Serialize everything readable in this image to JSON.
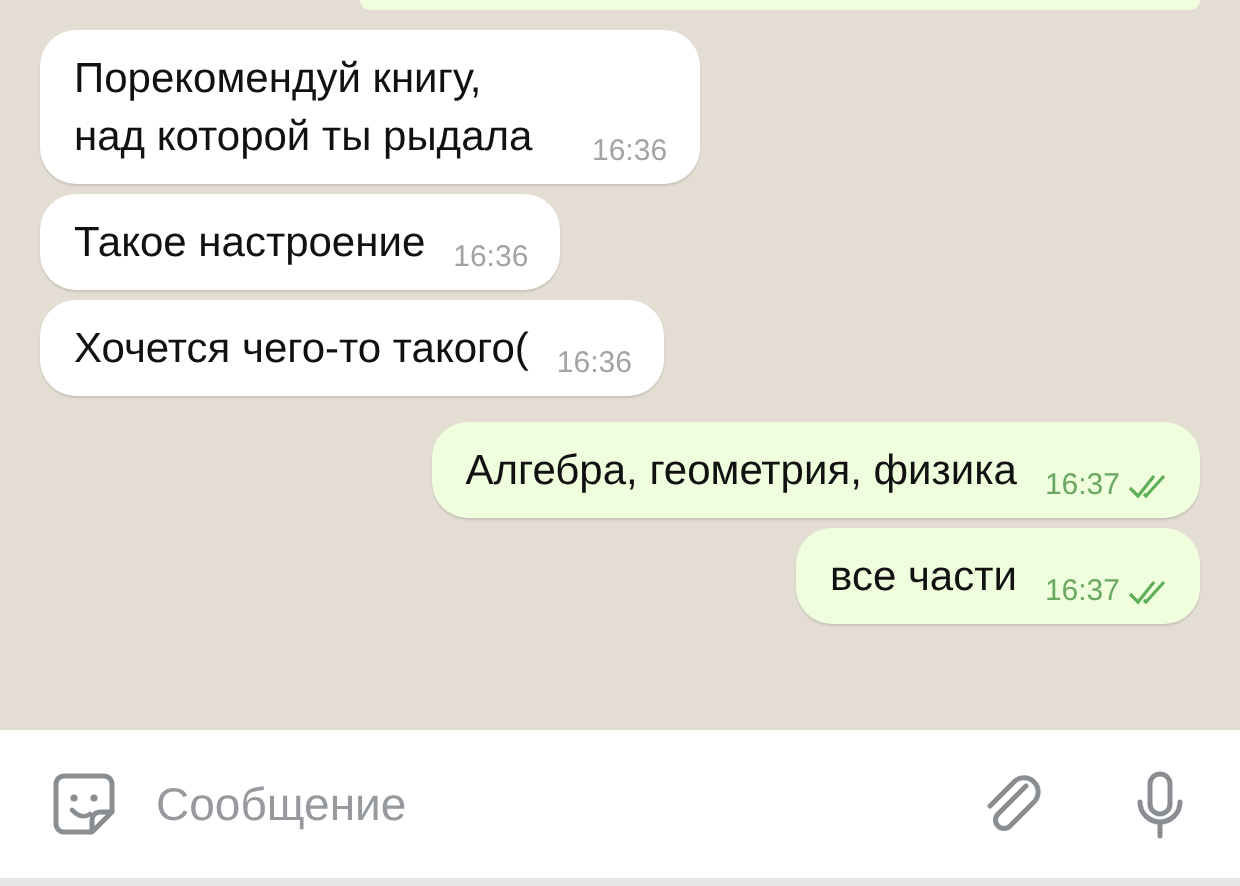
{
  "messages": [
    {
      "kind": "incoming",
      "text": "Порекомендуй книгу, над которой ты рыдала",
      "time": "16:36"
    },
    {
      "kind": "incoming",
      "text": "Такое настроение",
      "time": "16:36"
    },
    {
      "kind": "incoming",
      "text": "Хочется чего-то такого(",
      "time": "16:36"
    },
    {
      "kind": "outgoing",
      "text": "Алгебра, геометрия, физика",
      "time": "16:37",
      "read": true
    },
    {
      "kind": "outgoing",
      "text": "все части",
      "time": "16:37",
      "read": true
    }
  ],
  "composer": {
    "placeholder": "Сообщение"
  }
}
